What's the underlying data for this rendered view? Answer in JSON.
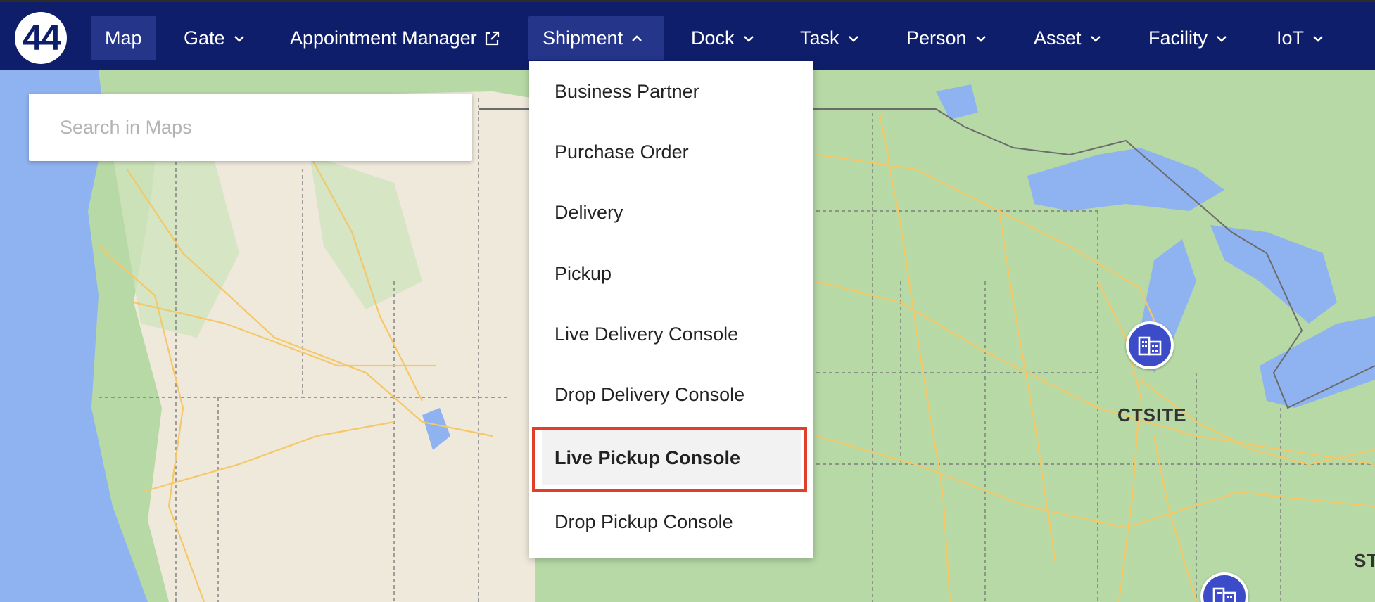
{
  "app": {
    "logo_text": "44"
  },
  "nav": {
    "items": [
      {
        "label": "Map",
        "active": true,
        "has_chevron": false
      },
      {
        "label": "Gate",
        "has_chevron": true
      },
      {
        "label": "Appointment Manager",
        "external_icon": "external-link-icon"
      },
      {
        "label": "Shipment",
        "open": true,
        "has_chevron": true
      },
      {
        "label": "Dock",
        "has_chevron": true
      },
      {
        "label": "Task",
        "has_chevron": true
      },
      {
        "label": "Person",
        "has_chevron": true
      },
      {
        "label": "Asset",
        "has_chevron": true
      },
      {
        "label": "Facility",
        "has_chevron": true
      },
      {
        "label": "IoT",
        "has_chevron": true
      }
    ]
  },
  "search": {
    "placeholder": "Search in Maps",
    "value": ""
  },
  "shipment_menu": {
    "items": [
      {
        "label": "Business Partner"
      },
      {
        "label": "Purchase Order"
      },
      {
        "label": "Delivery"
      },
      {
        "label": "Pickup"
      },
      {
        "label": "Live Delivery Console"
      },
      {
        "label": "Drop Delivery Console"
      },
      {
        "label": "Live Pickup Console",
        "highlighted": true
      },
      {
        "label": "Drop Pickup Console"
      }
    ]
  },
  "map": {
    "markers": [
      {
        "label": "CTSITE",
        "icon": "building-icon"
      },
      {
        "label": "ST",
        "icon": "building-icon"
      }
    ]
  },
  "colors": {
    "nav_bg": "#0f1e6a",
    "nav_active": "#24358a",
    "marker": "#3c4bc7",
    "highlight_border": "#e0402a",
    "water": "#8fb3f0",
    "land": "#b7d9a6",
    "desert": "#efe9dc",
    "roads": "#f5c766"
  }
}
